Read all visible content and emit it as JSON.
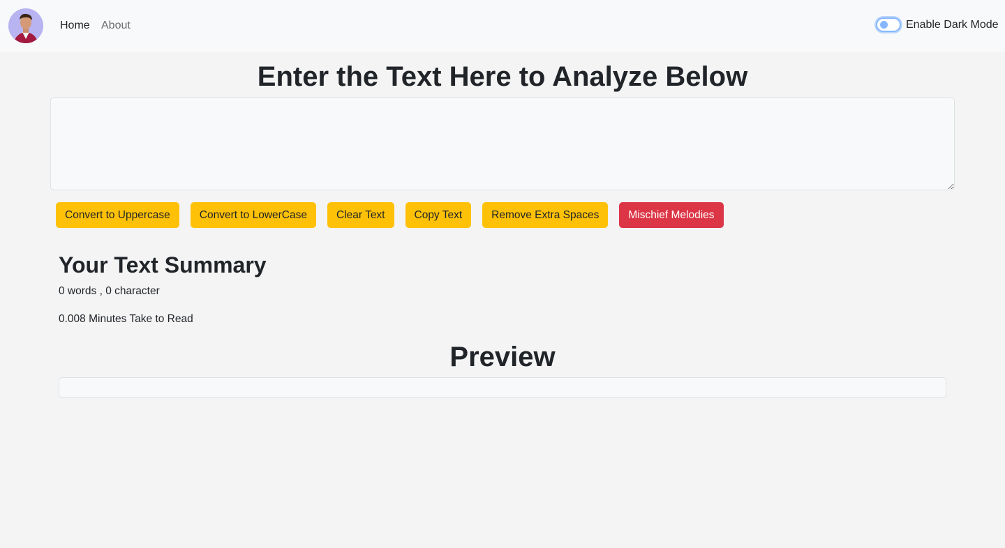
{
  "navbar": {
    "avatar_alt": "profile avatar",
    "links": [
      {
        "label": "Home"
      },
      {
        "label": "About"
      }
    ],
    "dark_mode_label": "Enable Dark Mode"
  },
  "editor": {
    "heading": "Enter the Text Here to Analyze Below",
    "textarea_value": "",
    "textarea_placeholder": ""
  },
  "buttons": [
    {
      "label": "Convert to Uppercase",
      "variant": "warning"
    },
    {
      "label": "Convert to LowerCase",
      "variant": "warning"
    },
    {
      "label": "Clear Text",
      "variant": "warning"
    },
    {
      "label": "Copy Text",
      "variant": "warning"
    },
    {
      "label": "Remove Extra Spaces",
      "variant": "warning"
    },
    {
      "label": "Mischief Melodies",
      "variant": "danger"
    }
  ],
  "summary": {
    "heading": "Your Text Summary",
    "counts": "0 words , 0 character",
    "read_time": "0.008 Minutes Take to Read"
  },
  "preview": {
    "heading": "Preview",
    "content": ""
  },
  "colors": {
    "warning": "#ffc107",
    "danger": "#dc3545",
    "navbar_bg": "#f8f9fa",
    "page_bg": "#f4f4f5",
    "switch_accent": "#86b7fe"
  }
}
